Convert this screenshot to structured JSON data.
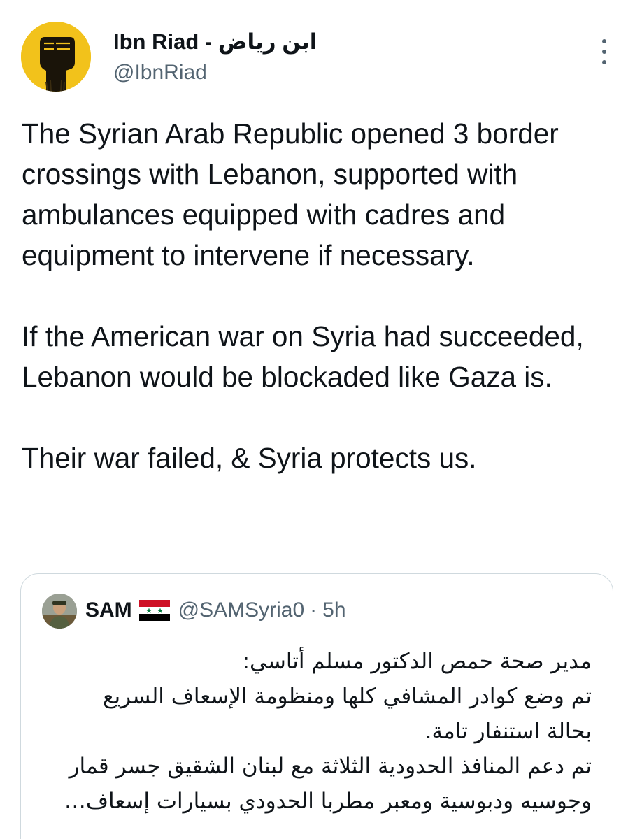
{
  "author": {
    "name": "Ibn Riad - ابن رياض",
    "handle": "@IbnRiad",
    "avatar_icon": "raised-fist-icon"
  },
  "tweet": {
    "paragraphs": [
      "The Syrian Arab Republic opened 3 border crossings with Lebanon, supported with ambulances equipped with cadres and equipment to intervene if necessary.",
      "If the American war on Syria had succeeded, Lebanon would be blockaded like Gaza is.",
      "Their war failed, & Syria protects us."
    ]
  },
  "quoted": {
    "name": "SAM",
    "flag_icon": "syria-flag-icon",
    "handle": "@SAMSyria0",
    "separator": "·",
    "time": "5h",
    "lines": [
      "مدير صحة حمص الدكتور مسلم أتاسي:",
      "تم وضع كوادر المشافي كلها ومنظومة الإسعاف السريع",
      "بحالة استنفار تامة.",
      "تم دعم المنافذ الحدودية الثلاثة مع لبنان الشقيق جسر قمار",
      "وجوسيه ودبوسية ومعبر مطربا الحدودي بسيارات إسعاف…"
    ]
  },
  "colors": {
    "text": "#0f1419",
    "secondary": "#536471",
    "border": "#cfd9de",
    "avatar_bg": "#f2c21b"
  }
}
